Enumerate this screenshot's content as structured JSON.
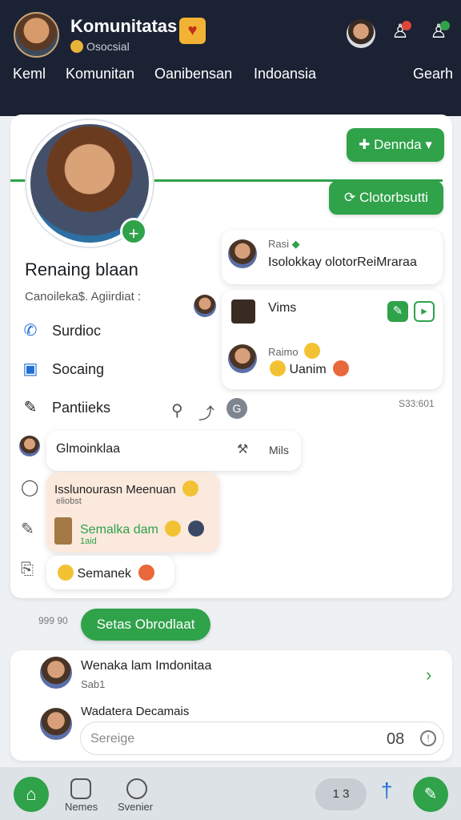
{
  "header": {
    "title": "Komunitatas",
    "subtitle": "Osocsial",
    "nav": [
      "Keml",
      "Komunitan",
      "Oanibensan",
      "Indoansia",
      "Gearh"
    ]
  },
  "profile": {
    "name": "Renaing blaan",
    "subtitle": "Canoileka$. Agiirdiat :",
    "follow_button": "Dennda",
    "collab_button": "Clotorbsutti",
    "menu": [
      "Surdioc",
      "Socaing",
      "Pantiieks"
    ]
  },
  "messages": {
    "m1_name": "Rasi",
    "m1_text": "Isolokkay olotorReiMraraa",
    "m2_title": "Vims",
    "m2_name": "Raimo",
    "m2_text": "Uanim",
    "timestamp": "S33:601",
    "m3_text": "Glmoinklaa",
    "m3_tag": "Mils",
    "m4_text": "Isslunourasn Meenuan",
    "m4_sub": "eliobst",
    "m5_text": "Semalka dam",
    "m5_sub": "1aid",
    "m6_text": "Semanek"
  },
  "status": {
    "time": "999 90",
    "button": "Setas Obrodlaat"
  },
  "recent": {
    "r1_title": "Wenaka lam Imdonitaa",
    "r1_sub": "Sab1",
    "r2_title": "Wadatera Decamais",
    "search_placeholder": "Sereige",
    "search_count": "08"
  },
  "bottom_nav": {
    "tab1": "Nemes",
    "tab2": "Svenier",
    "pill": "1 3"
  },
  "colors": {
    "accent": "#2fa24a",
    "header_bg": "#1b2233"
  }
}
